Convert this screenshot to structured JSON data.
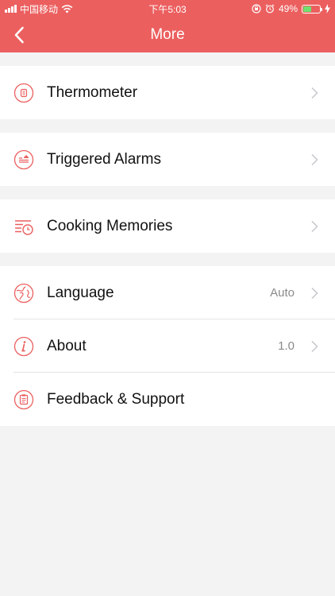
{
  "status_bar": {
    "carrier": "中国移动",
    "time": "下午5:03",
    "battery": "49%",
    "battery_level": 0.49,
    "icons": [
      "signal-icon",
      "wifi-icon",
      "rotation-lock-icon",
      "alarm-clock-icon",
      "battery-icon",
      "charging-bolt-icon"
    ]
  },
  "nav": {
    "title": "More",
    "back_icon": "chevron-left-icon"
  },
  "colors": {
    "accent": "#ec5f5f",
    "background": "#f4f3f4",
    "battery_fill": "#6ee06e"
  },
  "menu": {
    "thermometer": {
      "label": "Thermometer",
      "icon": "thermometer-icon"
    },
    "triggered_alarms": {
      "label": "Triggered Alarms",
      "icon": "alarm-list-icon"
    },
    "cooking_memories": {
      "label": "Cooking Memories",
      "icon": "history-clock-icon"
    },
    "language": {
      "label": "Language",
      "value": "Auto",
      "icon": "globe-icon"
    },
    "about": {
      "label": "About",
      "value": "1.0",
      "icon": "info-icon"
    },
    "feedback": {
      "label": "Feedback & Support",
      "icon": "clipboard-icon"
    }
  }
}
